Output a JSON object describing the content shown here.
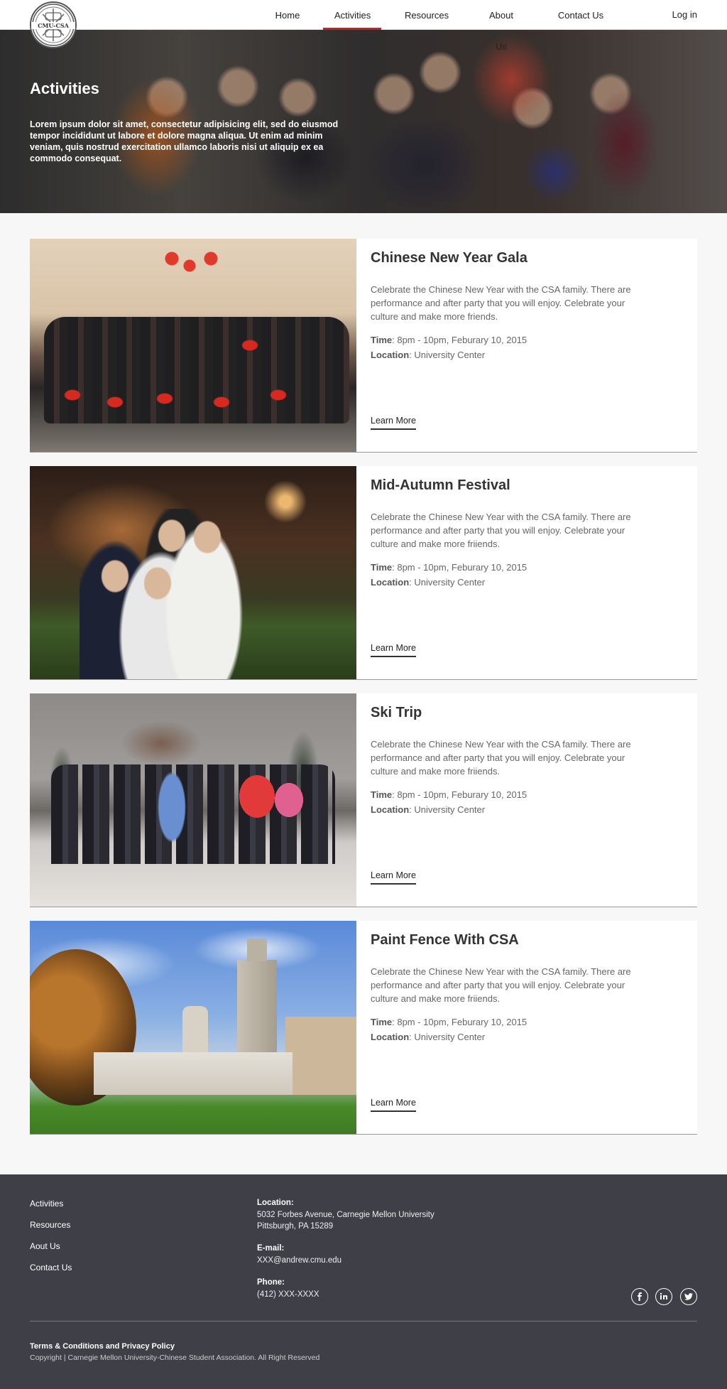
{
  "nav": {
    "logo_text": "CMU-CSA",
    "items": [
      {
        "label": "Home"
      },
      {
        "label": "Activities"
      },
      {
        "label": "Resources"
      },
      {
        "label": "About Us"
      },
      {
        "label": "Contact Us"
      }
    ],
    "active": "Activities",
    "login": "Log in",
    "accent_color": "#c0232c"
  },
  "hero": {
    "title": "Activities",
    "text": "Lorem ipsum dolor sit amet, consectetur adipisicing elit, sed do eiusmod tempor incididunt ut labore et dolore magna aliqua. Ut enim ad minim veniam, quis nostrud exercitation ullamco laboris nisi ut aliquip ex ea commodo consequat."
  },
  "activities": [
    {
      "title": "Chinese New Year Gala",
      "description": "Celebrate the Chinese New Year with the CSA family. There are performance and after party that you will enjoy. Celebrate your culture and make more friends.",
      "time_label": "Time",
      "time": ": 8pm - 10pm, Feburary 10, 2015",
      "location_label": "Location",
      "location": ": University Center",
      "cta": "Learn More"
    },
    {
      "title": "Mid-Autumn Festival",
      "description": "Celebrate the Chinese New Year with the CSA family. There are performance and after party that you will enjoy. Celebrate your culture and make more friiends.",
      "time_label": "Time",
      "time": ": 8pm - 10pm, Feburary 10, 2015",
      "location_label": "Location",
      "location": ": University Center",
      "cta": "Learn More"
    },
    {
      "title": "Ski Trip",
      "description": "Celebrate the Chinese New Year with the CSA family. There are performance and after party that you will enjoy. Celebrate your culture and make more friiends.",
      "time_label": "Time",
      "time": ": 8pm - 10pm, Feburary 10, 2015",
      "location_label": "Location",
      "location": ": University Center",
      "cta": "Learn More"
    },
    {
      "title": "Paint Fence With CSA",
      "description": "Celebrate the Chinese New Year with the CSA family. There are performance and after party that you will enjoy. Celebrate your culture and make more friiends.",
      "time_label": "Time",
      "time": ": 8pm - 10pm, Feburary 10, 2015",
      "location_label": "Location",
      "location": ": University Center",
      "cta": "Learn More"
    }
  ],
  "footer": {
    "links": [
      "Activities",
      "Resources",
      "Aout Us",
      "Contact Us"
    ],
    "location_label": "Location:",
    "location_line1": "5032 Forbes Avenue, Carnegie Mellon University",
    "location_line2": "Pittsburgh, PA 15289",
    "email_label": "E-mail:",
    "email": "XXX@andrew.cmu.edu",
    "phone_label": "Phone:",
    "phone": "(412) XXX-XXXX",
    "social": [
      "facebook-icon",
      "linkedin-icon",
      "twitter-icon"
    ],
    "terms": "Terms & Conditions and Privacy Policy",
    "copyright": "Copyright |  Carnegie Mellon University-Chinese Student Association. All Right Reserved",
    "background_color": "#3f3f48"
  }
}
